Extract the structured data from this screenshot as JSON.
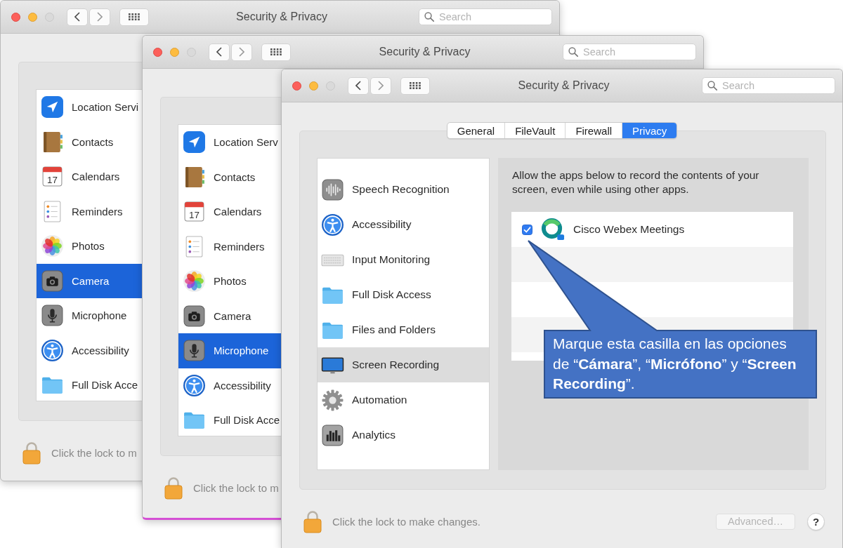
{
  "windows": [
    {
      "title": "Security & Privacy",
      "search": {
        "placeholder": "Search"
      },
      "privacy_list": {
        "focused": true,
        "items": [
          {
            "label": "Location Servi",
            "kind": "location",
            "selected": false
          },
          {
            "label": "Contacts",
            "kind": "contacts",
            "selected": false
          },
          {
            "label": "Calendars",
            "kind": "calendar",
            "icon_text": "17",
            "selected": false
          },
          {
            "label": "Reminders",
            "kind": "reminders",
            "selected": false
          },
          {
            "label": "Photos",
            "kind": "photos",
            "selected": false
          },
          {
            "label": "Camera",
            "kind": "camera",
            "selected": true
          },
          {
            "label": "Microphone",
            "kind": "microphone",
            "selected": false
          },
          {
            "label": "Accessibility",
            "kind": "accessibility",
            "selected": false
          },
          {
            "label": "Full Disk Acce",
            "kind": "folder",
            "selected": false
          }
        ]
      },
      "lock_text": "Click the lock to m"
    },
    {
      "title": "Security & Privacy",
      "search": {
        "placeholder": "Search"
      },
      "privacy_list": {
        "focused": true,
        "items": [
          {
            "label": "Location Serv",
            "kind": "location",
            "selected": false
          },
          {
            "label": "Contacts",
            "kind": "contacts",
            "selected": false
          },
          {
            "label": "Calendars",
            "kind": "calendar",
            "icon_text": "17",
            "selected": false
          },
          {
            "label": "Reminders",
            "kind": "reminders",
            "selected": false
          },
          {
            "label": "Photos",
            "kind": "photos",
            "selected": false
          },
          {
            "label": "Camera",
            "kind": "camera",
            "selected": false
          },
          {
            "label": "Microphone",
            "kind": "microphone",
            "selected": true
          },
          {
            "label": "Accessibility",
            "kind": "accessibility",
            "selected": false
          },
          {
            "label": "Full Disk Acce",
            "kind": "folder",
            "selected": false
          }
        ]
      },
      "lock_text": "Click the lock to m"
    },
    {
      "title": "Security & Privacy",
      "search": {
        "placeholder": "Search"
      },
      "tabs": [
        {
          "label": "General",
          "selected": false
        },
        {
          "label": "FileVault",
          "selected": false
        },
        {
          "label": "Firewall",
          "selected": false
        },
        {
          "label": "Privacy",
          "selected": true
        }
      ],
      "privacy_list": {
        "focused": false,
        "items": [
          {
            "label": "Speech Recognition",
            "kind": "speech",
            "selected": false
          },
          {
            "label": "Accessibility",
            "kind": "accessibility",
            "selected": false
          },
          {
            "label": "Input Monitoring",
            "kind": "keyboard",
            "selected": false
          },
          {
            "label": "Full Disk Access",
            "kind": "folder",
            "selected": false
          },
          {
            "label": "Files and Folders",
            "kind": "folder",
            "selected": false
          },
          {
            "label": "Screen Recording",
            "kind": "monitor",
            "selected": true
          },
          {
            "label": "Automation",
            "kind": "gear",
            "selected": false
          },
          {
            "label": "Analytics",
            "kind": "analytics",
            "selected": false
          }
        ]
      },
      "detail": {
        "description": "Allow the apps below to record the contents of your screen, even while using other apps.",
        "apps": [
          {
            "name": "Cisco Webex Meetings",
            "checked": true
          }
        ]
      },
      "lock_text": "Click the lock to make changes.",
      "advanced_button": {
        "label": "Advanced…",
        "disabled": true
      },
      "help_button": {
        "label": "?"
      }
    }
  ],
  "callout": {
    "text": "Marque esta casilla en las opciones de “**Cámara**”, “**Micrófono**” y “**Screen Recording**”."
  }
}
